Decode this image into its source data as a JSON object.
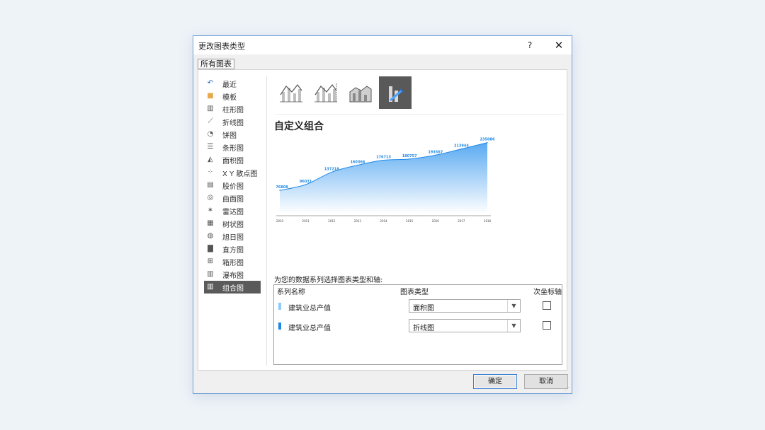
{
  "dialog": {
    "title": "更改图表类型",
    "help": "?",
    "close": "✕"
  },
  "tab": {
    "label": "所有图表"
  },
  "sidebar": {
    "items": [
      {
        "label": "最近",
        "icon": "recent-icon"
      },
      {
        "label": "模板",
        "icon": "folder-icon"
      },
      {
        "label": "柱形图",
        "icon": "column-chart-icon"
      },
      {
        "label": "折线图",
        "icon": "line-chart-icon"
      },
      {
        "label": "饼图",
        "icon": "pie-chart-icon"
      },
      {
        "label": "条形图",
        "icon": "bar-chart-icon"
      },
      {
        "label": "面积图",
        "icon": "area-chart-icon"
      },
      {
        "label": "X Y 散点图",
        "icon": "scatter-chart-icon"
      },
      {
        "label": "股价图",
        "icon": "stock-chart-icon"
      },
      {
        "label": "曲面图",
        "icon": "surface-chart-icon"
      },
      {
        "label": "雷达图",
        "icon": "radar-chart-icon"
      },
      {
        "label": "树状图",
        "icon": "treemap-chart-icon"
      },
      {
        "label": "旭日图",
        "icon": "sunburst-chart-icon"
      },
      {
        "label": "直方图",
        "icon": "histogram-chart-icon"
      },
      {
        "label": "箱形图",
        "icon": "boxplot-chart-icon"
      },
      {
        "label": "瀑布图",
        "icon": "waterfall-chart-icon"
      },
      {
        "label": "组合图",
        "icon": "combo-chart-icon",
        "selected": true
      }
    ]
  },
  "subtypes": {
    "items": [
      {
        "icon": "clustered-column-line-icon"
      },
      {
        "icon": "clustered-column-line-secondary-axis-icon"
      },
      {
        "icon": "stacked-area-clustered-column-icon"
      },
      {
        "icon": "custom-combination-icon",
        "selected": true
      }
    ]
  },
  "main": {
    "combo_title": "自定义组合",
    "instruction": "为您的数据系列选择图表类型和轴:"
  },
  "series_grid": {
    "headers": {
      "name": "系列名称",
      "type": "图表类型",
      "secondary_axis": "次坐标轴"
    },
    "rows": [
      {
        "name": "建筑业总产值",
        "chart_type": "面积图",
        "secondary_axis": false,
        "swatch_color": "#90caf9"
      },
      {
        "name": "建筑业总产值",
        "chart_type": "折线图",
        "secondary_axis": false,
        "swatch_color": "#1e88e5"
      }
    ]
  },
  "buttons": {
    "ok": "确定",
    "cancel": "取消"
  },
  "colors": {
    "accent": "#1e88e5",
    "area_top": "#5aaaf2",
    "area_bottom": "#ffffff",
    "dialog_border": "#6f9fd6",
    "selected_bg": "#595959"
  },
  "chart_data": {
    "type": "area",
    "x": [
      "2010",
      "2011",
      "2012",
      "2013",
      "2014",
      "2015",
      "2016",
      "2017",
      "2018"
    ],
    "series": [
      {
        "values": [
          76808,
          96031,
          137218,
          160366,
          176713,
          180757,
          193567,
          213944,
          235086
        ]
      }
    ],
    "data_labels": [
      "76808",
      "96031",
      "137218",
      "160366",
      "176713",
      "180757",
      "193567",
      "213944",
      "235086"
    ],
    "ylim": [
      0,
      260000
    ],
    "grid": false,
    "legend": "none"
  }
}
